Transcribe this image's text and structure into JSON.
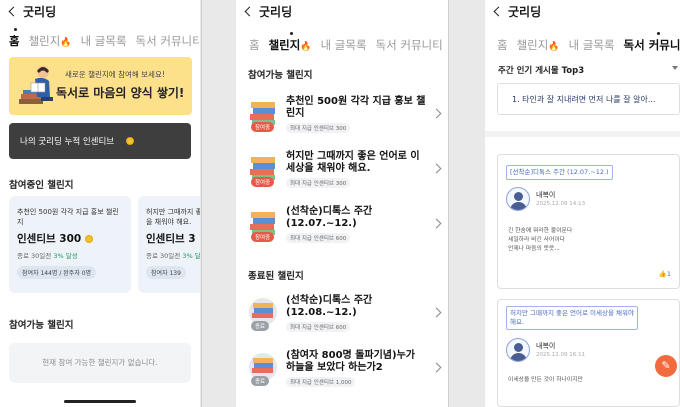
{
  "app_title": "굿리딩",
  "tabs": {
    "home": "홈",
    "challenge": "챌린지",
    "my_posts": "내 글목록",
    "community": "독서 커뮤니티"
  },
  "flame_glyph": "🔥",
  "screen1": {
    "banner_sub": "새로운 챌린지에 참여해 보세요!",
    "banner_main": "독서로 마음의 양식 쌓기!",
    "incentive_label": "나의 굿리딩 누적 인센티브",
    "participating_title": "참여중인 챌린지",
    "cards": [
      {
        "title": "추천인 500원 각각 지급 홍보 챌린지",
        "incentive": "인센티브 300",
        "status": "종료 30일전",
        "progress": "3% 달성",
        "participants": "참여자 144명 / 완주자 0명"
      },
      {
        "title": "허지만 그때까지 좋은 언어로 이세상을 채워야 해요.",
        "incentive": "인센티브 3",
        "status": "종료 30일전",
        "progress": "3% 달성",
        "participants": "참여자 139"
      }
    ],
    "available_title": "참여가능 챌린지",
    "empty_text": "현재 참여 가능한 챌린지가 없습니다."
  },
  "screen2": {
    "available_title": "참여가능 챌린지",
    "ended_title": "종료된 챌린지",
    "available": [
      {
        "title": "추천인 500원 각각 지급 홍보 챌린지",
        "badge": "참여중",
        "reward": "최대 지급 인센티브 300"
      },
      {
        "title": "허지만 그때까지 좋은 언어로 이세상을 채워야 해요.",
        "badge": "참여중",
        "reward": "최대 지급 인센티브 300"
      },
      {
        "title": "(선착순)디톡스 주간(12.07.~12.)",
        "badge": "참여중",
        "reward": "최대 지급 인센티브 600"
      }
    ],
    "ended": [
      {
        "title": "(선착순)디톡스 주간(12.08.~12.)",
        "badge": "종료",
        "reward": "최대 지급 인센티브 600"
      },
      {
        "title": "(참여자 800명 돌파기념)누가 하늘을 보았다 하는가2",
        "badge": "종료",
        "reward": "최대 지급 인센티브 1,000"
      }
    ]
  },
  "screen3": {
    "top3_title": "주간 인기 게시물 Top3",
    "top3_item": "1. 타인과 잘 지내려면 먼저 나를 잘 알아...",
    "posts": [
      {
        "tag": "[선착순]디톡스 주간 (12.07.~12.)",
        "nick": "내복이",
        "date": "2025.12.09 14:13",
        "body": [
          "긴 한숨에 뭐라한 불이문다",
          "세일하라 비긴 사어이다",
          "언제나 마음의 뜻뜻..."
        ],
        "likes": "1"
      },
      {
        "tag": "허지만 그때까지 좋은 언어로 이세상을 채워야 해요.",
        "nick": "내복이",
        "date": "2025.12.09 16:11",
        "body": [
          "이세상을 만든 것이 하나이지만"
        ],
        "likes": ""
      }
    ],
    "fab_icon": "✎"
  },
  "colors": {
    "banner": "#fde08a",
    "incentive_bg": "#3e3e3e",
    "accent_orange": "#f26a3d",
    "accent_blue": "#4a6bc4",
    "success": "#1f9a5a"
  }
}
